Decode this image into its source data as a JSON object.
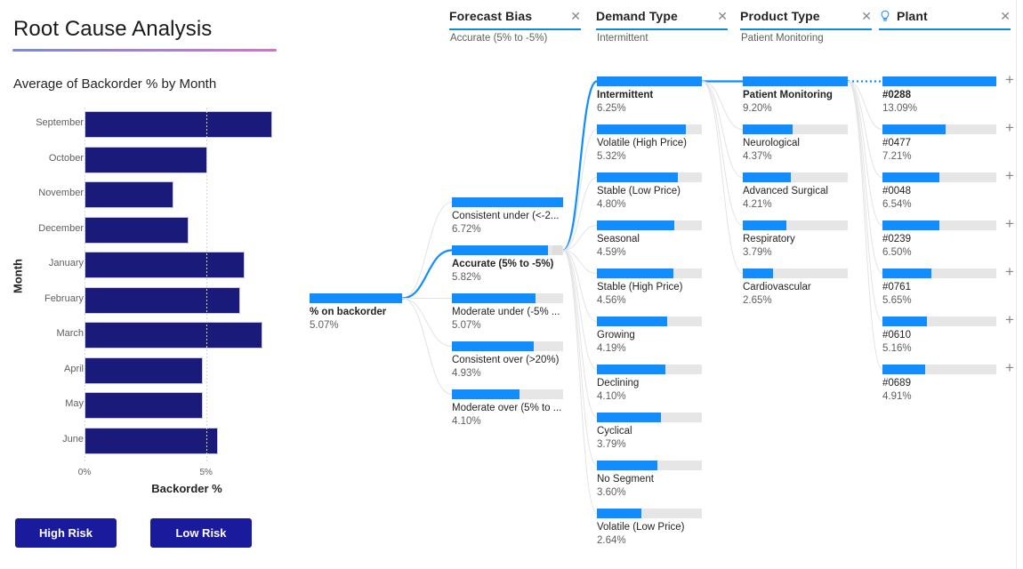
{
  "header": {
    "title": "Root Cause Analysis"
  },
  "bar_chart_panel": {
    "chart_title": "Average of Backorder % by Month",
    "buttons": [
      {
        "name": "high-risk",
        "label": "High Risk"
      },
      {
        "name": "low-risk",
        "label": "Low Risk"
      }
    ]
  },
  "chart_data": {
    "type": "bar",
    "title": "Average of Backorder % by Month",
    "orientation": "horizontal",
    "xlabel": "Backorder %",
    "ylabel": "Month",
    "xlim": [
      0,
      7.9
    ],
    "xticks": [
      0,
      5
    ],
    "xticklabels": [
      "0%",
      "5%"
    ],
    "grid": true,
    "bar_color": "#1a1a7a",
    "categories": [
      "September",
      "October",
      "November",
      "December",
      "January",
      "February",
      "March",
      "April",
      "May",
      "June"
    ],
    "values": [
      7.7,
      5.05,
      3.66,
      4.29,
      6.57,
      6.39,
      7.33,
      4.87,
      4.87,
      5.49
    ]
  },
  "filters": [
    {
      "name": "forecast-bias",
      "title": "Forecast Bias",
      "value": "Accurate (5% to -5%)",
      "close": "✕",
      "icon": null
    },
    {
      "name": "demand-type",
      "title": "Demand Type",
      "value": "Intermittent",
      "close": "✕",
      "icon": null
    },
    {
      "name": "product-type",
      "title": "Product Type",
      "value": "Patient Monitoring",
      "close": "✕",
      "icon": null
    },
    {
      "name": "plant",
      "title": "Plant",
      "value": "",
      "close": "✕",
      "icon": "lightbulb-icon"
    }
  ],
  "decomposition_tree": {
    "root": {
      "label": "% on backorder",
      "value": "5.07%",
      "selected": true,
      "fill_ratio": 1.0
    },
    "levels": [
      {
        "name": "forecast-bias-level",
        "nodes": [
          {
            "label": "Consistent under (<-2...",
            "value": "6.72%",
            "selected": false,
            "fill_ratio": 1.0
          },
          {
            "label": "Accurate (5% to -5%)",
            "value": "5.82%",
            "selected": true,
            "fill_ratio": 0.866
          },
          {
            "label": "Moderate under (-5% ...",
            "value": "5.07%",
            "selected": false,
            "fill_ratio": 0.754
          },
          {
            "label": "Consistent over (>20%)",
            "value": "4.93%",
            "selected": false,
            "fill_ratio": 0.733
          },
          {
            "label": "Moderate over (5% to ...",
            "value": "4.10%",
            "selected": false,
            "fill_ratio": 0.61
          }
        ]
      },
      {
        "name": "demand-type-level",
        "nodes": [
          {
            "label": "Intermittent",
            "value": "6.25%",
            "selected": true,
            "fill_ratio": 1.0
          },
          {
            "label": "Volatile (High Price)",
            "value": "5.32%",
            "selected": false,
            "fill_ratio": 0.851
          },
          {
            "label": "Stable (Low Price)",
            "value": "4.80%",
            "selected": false,
            "fill_ratio": 0.768
          },
          {
            "label": "Seasonal",
            "value": "4.59%",
            "selected": false,
            "fill_ratio": 0.734
          },
          {
            "label": "Stable (High Price)",
            "value": "4.56%",
            "selected": false,
            "fill_ratio": 0.73
          },
          {
            "label": "Growing",
            "value": "4.19%",
            "selected": false,
            "fill_ratio": 0.67
          },
          {
            "label": "Declining",
            "value": "4.10%",
            "selected": false,
            "fill_ratio": 0.656
          },
          {
            "label": "Cyclical",
            "value": "3.79%",
            "selected": false,
            "fill_ratio": 0.606
          },
          {
            "label": "No Segment",
            "value": "3.60%",
            "selected": false,
            "fill_ratio": 0.576
          },
          {
            "label": "Volatile (Low Price)",
            "value": "2.64%",
            "selected": false,
            "fill_ratio": 0.422
          }
        ]
      },
      {
        "name": "product-type-level",
        "nodes": [
          {
            "label": "Patient Monitoring",
            "value": "9.20%",
            "selected": true,
            "fill_ratio": 1.0
          },
          {
            "label": "Neurological",
            "value": "4.37%",
            "selected": false,
            "fill_ratio": 0.475
          },
          {
            "label": "Advanced Surgical",
            "value": "4.21%",
            "selected": false,
            "fill_ratio": 0.458
          },
          {
            "label": "Respiratory",
            "value": "3.79%",
            "selected": false,
            "fill_ratio": 0.412
          },
          {
            "label": "Cardiovascular",
            "value": "2.65%",
            "selected": false,
            "fill_ratio": 0.288
          }
        ]
      },
      {
        "name": "plant-level",
        "expand_glyph": "+",
        "nodes": [
          {
            "label": "#0288",
            "value": "13.09%",
            "selected": true,
            "fill_ratio": 1.0
          },
          {
            "label": "#0477",
            "value": "7.21%",
            "selected": false,
            "fill_ratio": 0.551
          },
          {
            "label": "#0048",
            "value": "6.54%",
            "selected": false,
            "fill_ratio": 0.5
          },
          {
            "label": "#0239",
            "value": "6.50%",
            "selected": false,
            "fill_ratio": 0.497
          },
          {
            "label": "#0761",
            "value": "5.65%",
            "selected": false,
            "fill_ratio": 0.432
          },
          {
            "label": "#0610",
            "value": "5.16%",
            "selected": false,
            "fill_ratio": 0.394
          },
          {
            "label": "#0689",
            "value": "4.91%",
            "selected": false,
            "fill_ratio": 0.375
          }
        ]
      }
    ]
  },
  "colors": {
    "accent_blue": "#118DFF",
    "bar_navy": "#1a1a7a",
    "button_blue": "#1a1a9c",
    "track_gray": "#e6e6e6"
  }
}
